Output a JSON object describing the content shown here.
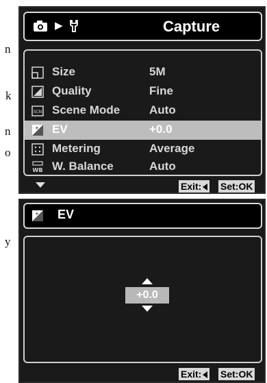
{
  "margin_text": [
    "n",
    "k",
    "n",
    "o",
    "y"
  ],
  "screen1": {
    "header": {
      "title": "Capture",
      "icons": [
        "camera-icon",
        "play-icon",
        "wrench-icon"
      ]
    },
    "menu": [
      {
        "label": "Size",
        "value": "5M",
        "icon": "size-icon"
      },
      {
        "label": "Quality",
        "value": "Fine",
        "icon": "quality-icon"
      },
      {
        "label": "Scene Mode",
        "value": "Auto",
        "icon": "scene-mode-icon"
      },
      {
        "label": "EV",
        "value": "+0.0",
        "icon": "ev-icon",
        "selected": true
      },
      {
        "label": "Metering",
        "value": "Average",
        "icon": "metering-icon"
      },
      {
        "label": "W. Balance",
        "value": "Auto",
        "icon": "white-balance-icon"
      }
    ],
    "footer": {
      "exit": "Exit:",
      "set": "Set:OK"
    }
  },
  "screen2": {
    "header": {
      "title": "EV"
    },
    "value": "+0.0",
    "footer": {
      "exit": "Exit:",
      "set": "Set:OK"
    }
  },
  "colors": {
    "screen_bg": "#1a1a1a",
    "highlight": "#bdbdbd",
    "border": "#d0d0d0",
    "text": "#d8d8d8"
  }
}
